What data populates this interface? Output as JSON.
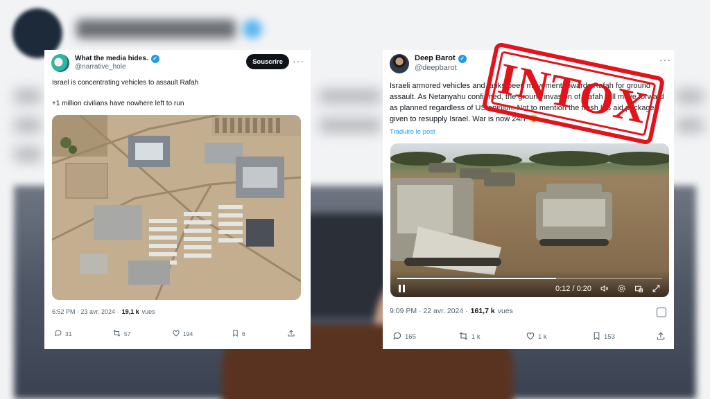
{
  "left_tweet": {
    "display_name": "What the media hides.",
    "handle": "@narrative_hole",
    "subscribe_label": "Souscrire",
    "text_line1": "Israel is concentrating vehicles to assault Rafah",
    "text_line2": "+1 million civilians have nowhere left to run",
    "timestamp": "6:52 PM · 23 avr. 2024 ·",
    "views_count": "19,1 k",
    "views_label": "vues",
    "replies": "31",
    "reposts": "57",
    "likes": "194",
    "bookmarks": "6"
  },
  "right_tweet": {
    "display_name": "Deep Barot",
    "handle": "@deepbarot",
    "text": "Israeli armored vehicles and tanks been movement towards Rafah for ground assault. As Netanyahu confirmed, the ground invasion of Rafah will move forward as planned regardless of US opinion. Not to mention the fresh US aid package given to resupply Israel. War is now 24/7 😏",
    "translate_label": "Traduire le post",
    "video_time": "0:12 / 0:20",
    "video_progress": 0.6,
    "timestamp": "9:09 PM · 22 avr. 2024 ·",
    "views_count": "161,7 k",
    "views_label": "vues",
    "replies": "165",
    "reposts": "1 k",
    "likes": "1 k",
    "bookmarks": "153"
  },
  "stamp": {
    "text": "INTOX",
    "color": "#e2131a"
  },
  "colors": {
    "accent": "#1d9bf0",
    "text_secondary": "#536471"
  }
}
